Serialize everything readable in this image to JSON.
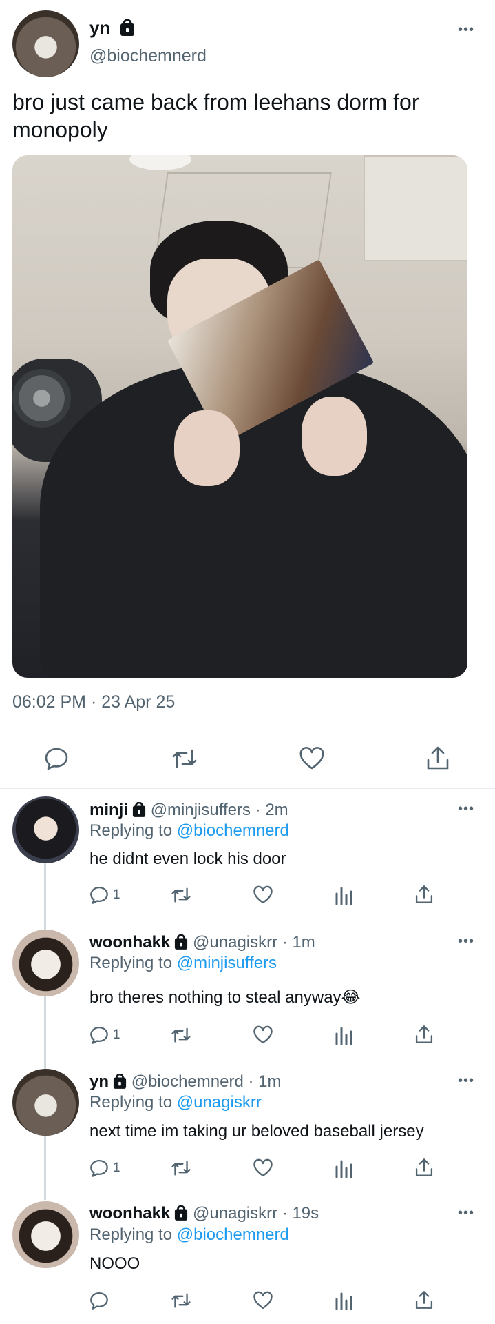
{
  "main_post": {
    "display_name": "yn",
    "handle": "@biochemnerd",
    "text_line1": "bro just came back from leehans dorm for",
    "text_line2": "monopoly",
    "timestamp": "06:02 PM · 23 Apr 25",
    "actions": [
      "comment-icon",
      "retweet-icon",
      "heart-icon",
      "share-icon"
    ]
  },
  "replies": [
    {
      "display_name": "minji",
      "handle": "@minjisuffers",
      "time": "· 2m",
      "replying_prefix": "Replying to",
      "replying_to": "@biochemnerd",
      "text": "he didnt even lock his door",
      "reply_count": "1"
    },
    {
      "display_name": "woonhakk",
      "handle": "@unagiskrr",
      "time": "· 1m",
      "replying_prefix": "Replying to",
      "replying_to": "@minjisuffers",
      "text": "bro theres nothing to steal anyway😂",
      "reply_count": "1"
    },
    {
      "display_name": "yn",
      "handle": "@biochemnerd",
      "time": "· 1m",
      "replying_prefix": "Replying to",
      "replying_to": "@unagiskrr",
      "text": "next time im taking ur beloved baseball jersey",
      "reply_count": "1"
    },
    {
      "display_name": "woonhakk",
      "handle": "@unagiskrr",
      "time": "· 19s",
      "replying_prefix": "Replying to",
      "replying_to": "@biochemnerd",
      "text": "NOOO",
      "reply_count": ""
    }
  ],
  "more_label": "•••",
  "colors": {
    "link": "#1d9bf0",
    "muted": "#536471",
    "divider": "#e6ecf0"
  }
}
